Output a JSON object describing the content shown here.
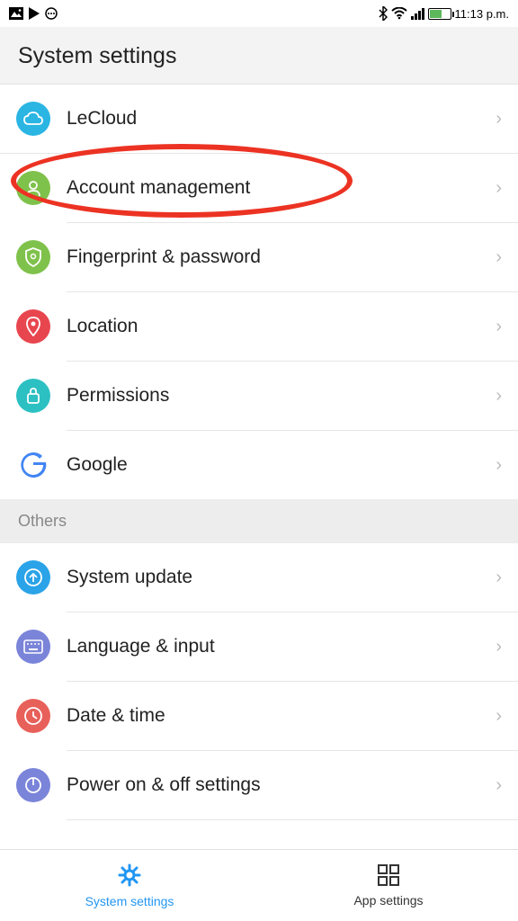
{
  "status_bar": {
    "time": "11:13 p.m."
  },
  "header": {
    "title": "System settings"
  },
  "items": [
    {
      "label": "LeCloud"
    },
    {
      "label": "Account management"
    },
    {
      "label": "Fingerprint & password"
    },
    {
      "label": "Location"
    },
    {
      "label": "Permissions"
    },
    {
      "label": "Google"
    }
  ],
  "section_others": "Others",
  "items_others": [
    {
      "label": "System update"
    },
    {
      "label": "Language & input"
    },
    {
      "label": "Date & time"
    },
    {
      "label": "Power on & off settings"
    }
  ],
  "bottom_nav": {
    "system_settings": "System settings",
    "app_settings": "App settings"
  }
}
